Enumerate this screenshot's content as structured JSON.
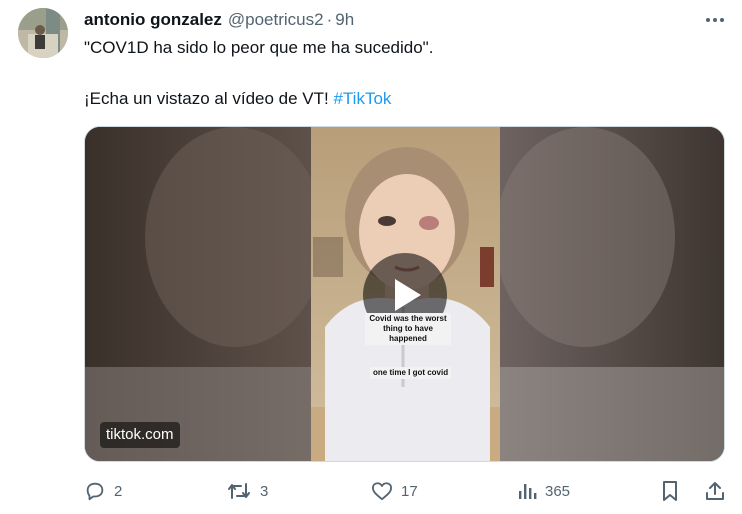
{
  "tweet": {
    "author_name": "antonio gonzalez",
    "author_handle": "@poetricus2",
    "separator": "·",
    "time": "9h",
    "text_line1": "\"COV1D ha sido lo peor que me ha sucedido\".",
    "text_line2_prefix": "¡Echa un vistazo al vídeo de VT! ",
    "hashtag": "#TikTok"
  },
  "media": {
    "source_label": "tiktok.com",
    "caption_top": "Covid was the worst\nthing to have happened",
    "caption_bottom": "one time I got covid"
  },
  "actions": {
    "replies": "2",
    "retweets": "3",
    "likes": "17",
    "views": "365"
  },
  "icons": [
    "more-icon",
    "play-icon",
    "reply-icon",
    "retweet-icon",
    "like-icon",
    "views-icon",
    "bookmark-icon",
    "share-icon"
  ],
  "colors": {
    "link": "#1d9bf0",
    "secondary_text": "#536471",
    "primary_text": "#0f1419"
  }
}
